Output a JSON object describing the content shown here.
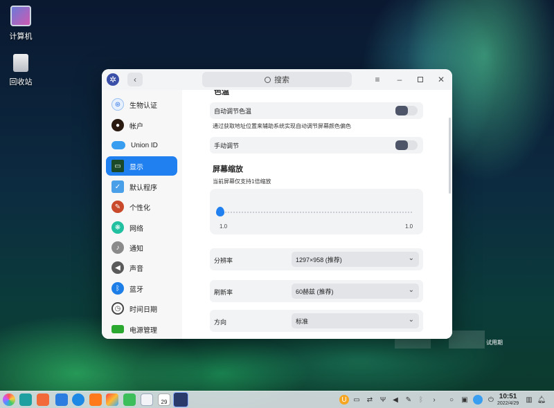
{
  "desktop": {
    "icons": [
      {
        "label": "计算机",
        "icon": "computer-icon"
      },
      {
        "label": "回收站",
        "icon": "trash-icon"
      }
    ],
    "watermark": "试用期"
  },
  "window": {
    "search_label": "搜索",
    "sidebar": [
      {
        "label": "生物认证",
        "icon": "fingerprint-icon",
        "color": "#e6f0ff"
      },
      {
        "label": "帐户",
        "icon": "user-icon",
        "color": "#2a1a10"
      },
      {
        "label": "Union ID",
        "icon": "cloud-icon",
        "color": "#3a9ef0"
      },
      {
        "label": "显示",
        "icon": "monitor-icon",
        "color": "#1a4a2a",
        "active": true
      },
      {
        "label": "默认程序",
        "icon": "default-apps-icon",
        "color": "#4aa0e8"
      },
      {
        "label": "个性化",
        "icon": "palette-icon",
        "color": "#c84a2a"
      },
      {
        "label": "网络",
        "icon": "network-icon",
        "color": "#20c0a0"
      },
      {
        "label": "通知",
        "icon": "bell-icon",
        "color": "#8a8a8a"
      },
      {
        "label": "声音",
        "icon": "speaker-icon",
        "color": "#5a5a5a"
      },
      {
        "label": "蓝牙",
        "icon": "bluetooth-icon",
        "color": "#1e7ee8"
      },
      {
        "label": "时间日期",
        "icon": "clock-icon",
        "color": "#444"
      },
      {
        "label": "电源管理",
        "icon": "battery-icon",
        "color": "#2aa830"
      }
    ],
    "content": {
      "partial_header": "色温",
      "auto_temp_label": "自动调节色温",
      "auto_temp_note": "通过获取地址位置来辅助系统实现自动调节屏幕颜色偏色",
      "manual_label": "手动调节",
      "scaling_title": "屏幕缩放",
      "scaling_note": "当前屏幕仅支持1倍缩放",
      "slider_min": "1.0",
      "slider_max": "1.0",
      "resolution_label": "分辨率",
      "resolution_value": "1297×958 (推荐)",
      "refresh_label": "刷新率",
      "refresh_value": "60赫兹 (推荐)",
      "orientation_label": "方向",
      "orientation_value": "标准"
    }
  },
  "taskbar": {
    "time": "10:51",
    "date": "2022/4/29",
    "calendar_day": "29"
  }
}
